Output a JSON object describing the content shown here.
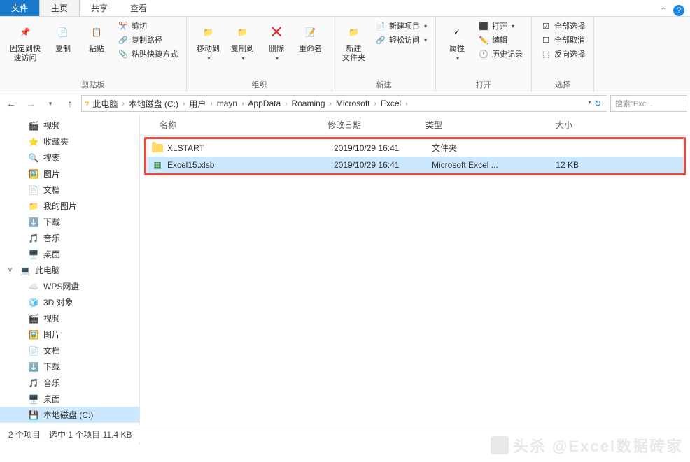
{
  "tabs": {
    "file": "文件",
    "home": "主页",
    "share": "共享",
    "view": "查看"
  },
  "ribbon": {
    "clipboard": {
      "pin": "固定到快\n速访问",
      "copy": "复制",
      "paste": "粘贴",
      "cut": "剪切",
      "copyPath": "复制路径",
      "pasteShortcut": "粘贴快捷方式",
      "groupLabel": "剪贴板"
    },
    "organize": {
      "moveTo": "移动到",
      "copyTo": "复制到",
      "delete": "删除",
      "rename": "重命名",
      "groupLabel": "组织"
    },
    "new": {
      "newFolder": "新建\n文件夹",
      "newItem": "新建项目",
      "easyAccess": "轻松访问",
      "groupLabel": "新建"
    },
    "open": {
      "properties": "属性",
      "open": "打开",
      "edit": "编辑",
      "history": "历史记录",
      "groupLabel": "打开"
    },
    "select": {
      "selectAll": "全部选择",
      "selectNone": "全部取消",
      "invertSelection": "反向选择",
      "groupLabel": "选择"
    }
  },
  "breadcrumb": {
    "items": [
      "此电脑",
      "本地磁盘 (C:)",
      "用户",
      "mayn",
      "AppData",
      "Roaming",
      "Microsoft",
      "Excel"
    ]
  },
  "search": {
    "placeholder": "搜索\"Exc..."
  },
  "sidebar": {
    "items": [
      {
        "label": "视频",
        "icon": "video",
        "level": 1
      },
      {
        "label": "收藏夹",
        "icon": "star",
        "level": 1
      },
      {
        "label": "搜索",
        "icon": "search",
        "level": 1
      },
      {
        "label": "图片",
        "icon": "image",
        "level": 1
      },
      {
        "label": "文档",
        "icon": "document",
        "level": 1
      },
      {
        "label": "我的图片",
        "icon": "folder",
        "level": 1
      },
      {
        "label": "下载",
        "icon": "download",
        "level": 1
      },
      {
        "label": "音乐",
        "icon": "music",
        "level": 1
      },
      {
        "label": "桌面",
        "icon": "desktop",
        "level": 1
      },
      {
        "label": "此电脑",
        "icon": "pc",
        "level": 0,
        "expand": "v"
      },
      {
        "label": "WPS网盘",
        "icon": "cloud",
        "level": 1
      },
      {
        "label": "3D 对象",
        "icon": "3d",
        "level": 1
      },
      {
        "label": "视频",
        "icon": "video",
        "level": 1
      },
      {
        "label": "图片",
        "icon": "image",
        "level": 1
      },
      {
        "label": "文档",
        "icon": "document",
        "level": 1
      },
      {
        "label": "下载",
        "icon": "download",
        "level": 1
      },
      {
        "label": "音乐",
        "icon": "music",
        "level": 1
      },
      {
        "label": "桌面",
        "icon": "desktop",
        "level": 1
      },
      {
        "label": "本地磁盘 (C:)",
        "icon": "drive",
        "level": 1,
        "selected": true
      }
    ]
  },
  "fileList": {
    "columns": {
      "name": "名称",
      "date": "修改日期",
      "type": "类型",
      "size": "大小"
    },
    "rows": [
      {
        "name": "XLSTART",
        "date": "2019/10/29 16:41",
        "type": "文件夹",
        "size": "",
        "icon": "folder"
      },
      {
        "name": "Excel15.xlsb",
        "date": "2019/10/29 16:41",
        "type": "Microsoft Excel ...",
        "size": "12 KB",
        "icon": "excel",
        "selected": true
      }
    ]
  },
  "statusBar": {
    "itemCount": "2 个项目",
    "selection": "选中 1 个项目 11.4 KB"
  },
  "watermark": "头杀 @Excel数据砖家"
}
